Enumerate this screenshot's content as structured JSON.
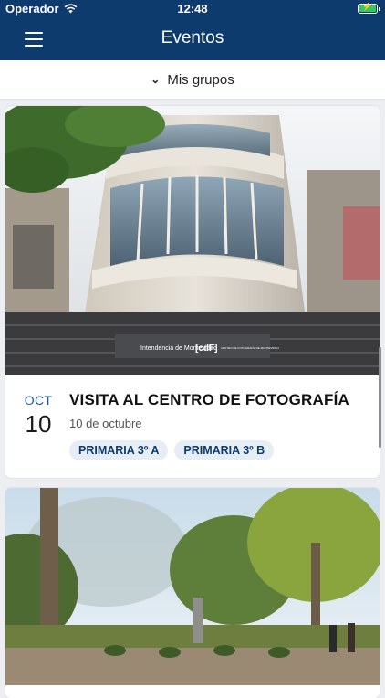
{
  "status_bar": {
    "carrier": "Operador",
    "time": "12:48"
  },
  "nav": {
    "title": "Eventos"
  },
  "group_selector": {
    "label": "Mis grupos"
  },
  "events": [
    {
      "month": "OCT",
      "day": "10",
      "title": "VISITA AL CENTRO DE FOTOGRAFÍA",
      "date_text": "10 de octubre",
      "tags": [
        "PRIMARIA 3º A",
        "PRIMARIA 3º B"
      ],
      "image_signage": {
        "org": "Intendencia de Montevideo",
        "brand": "[cdF]",
        "brand_sub": "CENTRO DE FOTOGRAFÍA DE MONTEVIDEO"
      }
    }
  ],
  "colors": {
    "primary": "#0d3b6e",
    "accent": "#1a57a6",
    "tag_bg": "#e7edf4",
    "battery": "#34c759"
  },
  "icons": [
    "menu-icon",
    "chevron-down-icon",
    "wifi-icon",
    "battery-icon"
  ]
}
